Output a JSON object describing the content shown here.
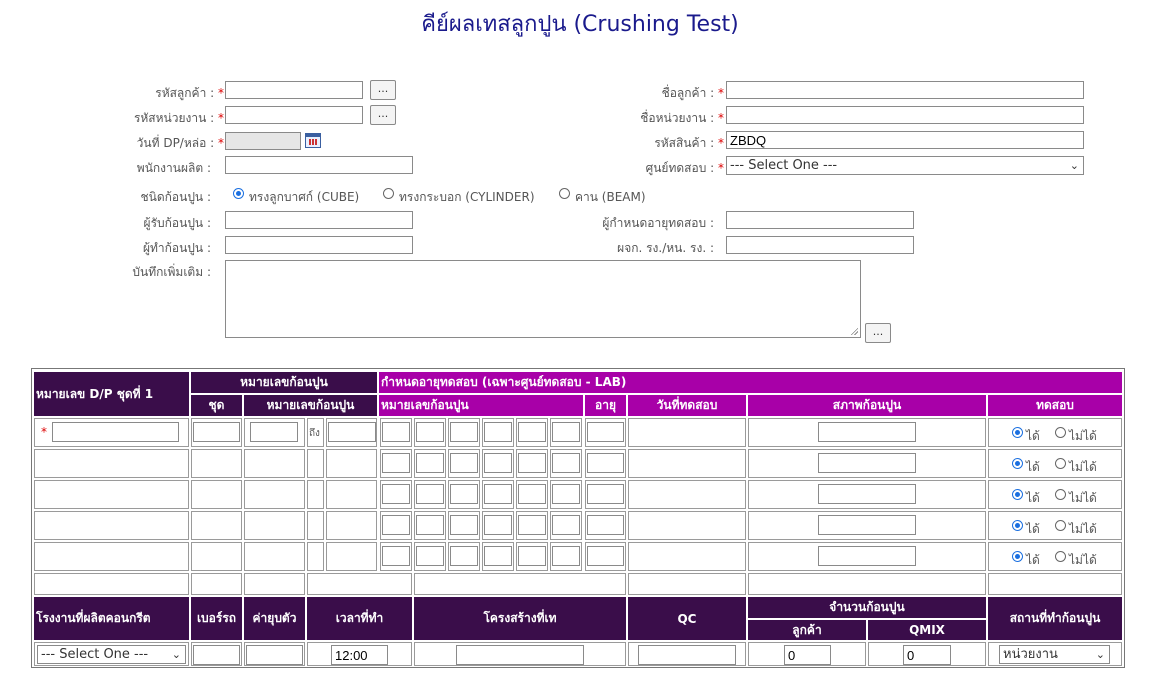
{
  "title": "คีย์ผลเทสลูกปูน (Crushing Test)",
  "required_mark": "*",
  "browse_label": "...",
  "form": {
    "customer_code_label": "รหัสลูกค้า :",
    "site_code_label": "รหัสหน่วยงาน :",
    "dp_date_label": "วันที่ DP/หล่อ :",
    "production_staff_label": "พนักงานผลิต :",
    "customer_name_label": "ชื่อลูกค้า :",
    "site_name_label": "ชื่อหน่วยงาน :",
    "product_code_label": "รหัสสินค้า :",
    "product_code_value": "ZBDQ",
    "test_center_label": "ศูนย์ทดสอบ :",
    "test_center_value": "--- Select One ---",
    "specimen_type_label": "ชนิดก้อนปูน :",
    "specimen_types": [
      "ทรงลูกบาศก์ (CUBE)",
      "ทรงกระบอก (CYLINDER)",
      "คาน (BEAM)"
    ],
    "receiver_label": "ผู้รับก้อนปูน :",
    "maker_label": "ผู้ทำก้อนปูน :",
    "age_setter_label": "ผู้กำหนดอายุทดสอบ :",
    "manager_label": "ผจก. รง./หน. รง. :",
    "notes_label": "บันทึกเพิ่มเติม :"
  },
  "table": {
    "h_dp_set": "หมายเลข D/P ชุดที่ 1",
    "h_specimen_no": "หมายเลขก้อนปูน",
    "h_lab_age": "กำหนดอายุทดสอบ (เฉพาะศูนย์ทดสอบ - LAB)",
    "h_set": "ชุด",
    "h_specimen_no2": "หมายเลขก้อนปูน",
    "h_specimen_no3": "หมายเลขก้อนปูน",
    "h_age": "อายุ",
    "h_test_date": "วันที่ทดสอบ",
    "h_condition": "สภาพก้อนปูน",
    "h_test": "ทดสอบ",
    "to_label": "ถึง",
    "radio_yes": "ได้",
    "radio_no": "ไม่ได้",
    "h_plant": "โรงงานที่ผลิตคอนกรีต",
    "h_truck": "เบอร์รถ",
    "h_slump": "ค่ายุบตัว",
    "h_time": "เวลาที่ทำ",
    "h_structure": "โครงสร้างที่เท",
    "h_qc": "QC",
    "h_count": "จำนวนก้อนปูน",
    "h_customer": "ลูกค้า",
    "h_qmix": "QMIX",
    "h_place": "สถานที่ทำก้อนปูน",
    "plant_value": "--- Select One ---",
    "time_value": "12:00",
    "customer_count": "0",
    "qmix_count": "0",
    "place_value": "หน่วยงาน"
  }
}
